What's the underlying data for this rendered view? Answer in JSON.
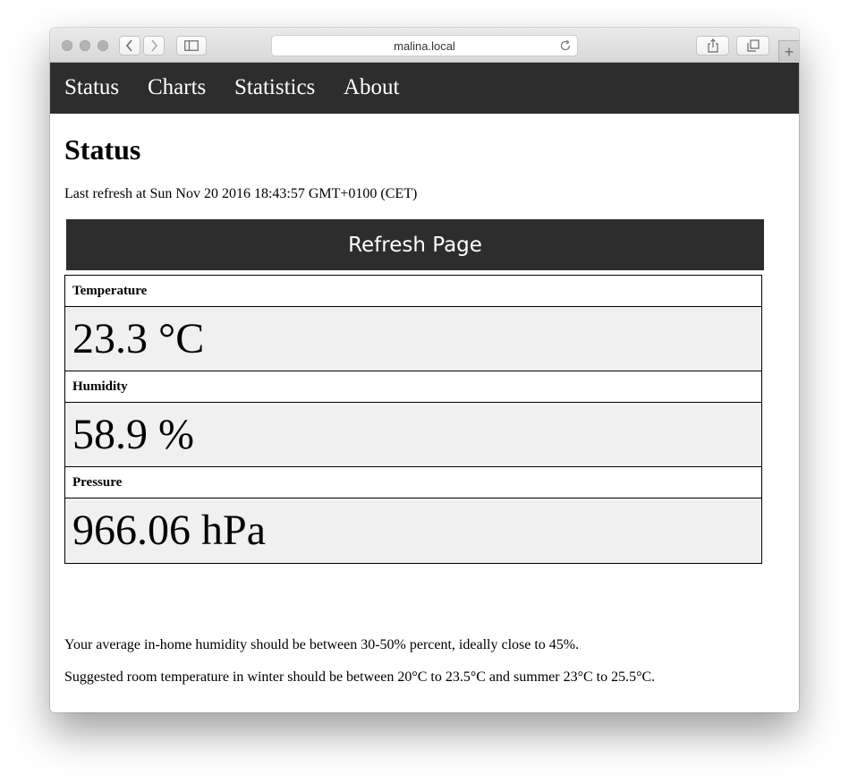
{
  "browser": {
    "address": "malina.local",
    "icons": {
      "back": "chevron-left-icon",
      "forward": "chevron-right-icon",
      "sidebar": "sidebar-icon",
      "reload": "reload-icon",
      "share": "share-icon",
      "tabs": "tabs-overview-icon",
      "new_tab": "plus-icon"
    },
    "new_tab_label": "+"
  },
  "nav": {
    "items": [
      {
        "label": "Status"
      },
      {
        "label": "Charts"
      },
      {
        "label": "Statistics"
      },
      {
        "label": "About"
      }
    ],
    "background": "#2d2d2d"
  },
  "page": {
    "title": "Status",
    "last_refresh": "Last refresh at Sun Nov 20 2016 18:43:57 GMT+0100 (CET)",
    "refresh_button": "Refresh Page"
  },
  "readings": [
    {
      "label": "Temperature",
      "value": "23.3 °C"
    },
    {
      "label": "Humidity",
      "value": "58.9 %"
    },
    {
      "label": "Pressure",
      "value": "966.06 hPa"
    }
  ],
  "notes": [
    "Your average in-home humidity should be between 30-50% percent, ideally close to 45%.",
    "Suggested room temperature in winter should be between 20°C to 23.5°C and summer 23°C to 25.5°C."
  ],
  "colors": {
    "nav_background": "#2d2d2d",
    "value_background": "#f0f0f0"
  }
}
